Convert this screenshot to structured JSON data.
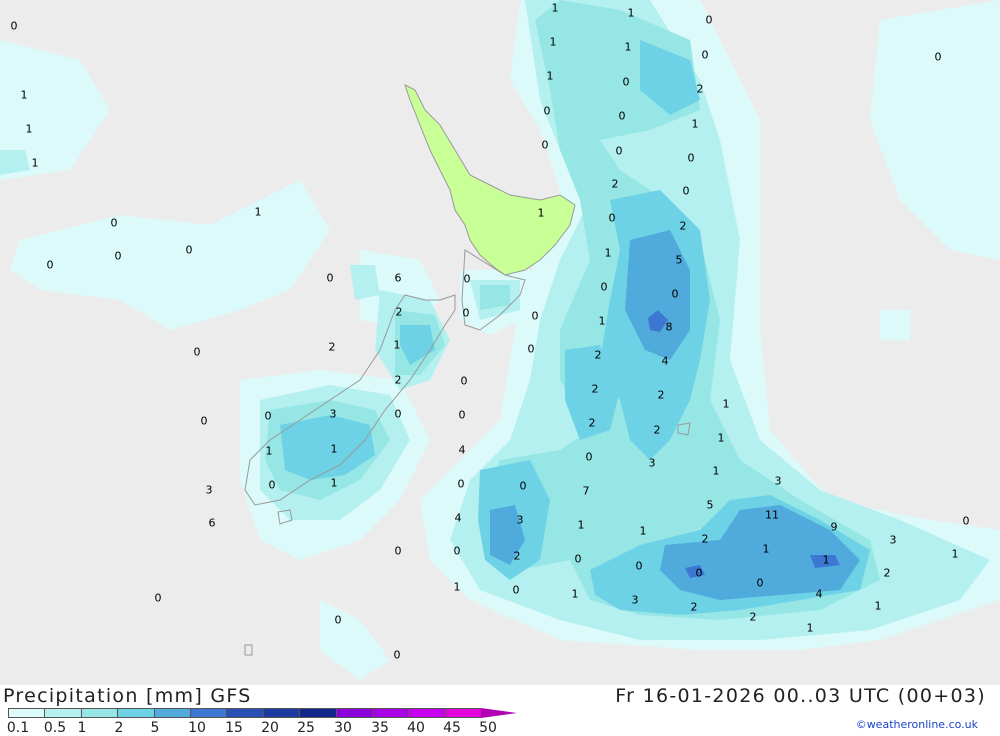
{
  "colors": {
    "ocean": "#ececec",
    "land_dry": "#c8ff96",
    "coast": "#999999",
    "precip_01": "#dcfafa",
    "precip_05": "#b4f0f0",
    "precip_1": "#96e6e6",
    "precip_2": "#6ed2e6",
    "precip_5": "#50aadc",
    "precip_10": "#3c78d2",
    "credit": "#1a44c8"
  },
  "map": {
    "labels": [
      "1",
      "1",
      "0",
      "0",
      "1",
      "1",
      "0",
      "0",
      "1",
      "0",
      "2",
      "1",
      "0",
      "0",
      "1",
      "1",
      "0",
      "0",
      "1",
      "0",
      "2",
      "0",
      "1",
      "1",
      "0",
      "0",
      "2",
      "0",
      "0",
      "5",
      "0",
      "1",
      "0",
      "6",
      "0",
      "0",
      "0",
      "0",
      "2",
      "8",
      "0",
      "1",
      "4",
      "2",
      "0",
      "2",
      "0",
      "1",
      "2",
      "0",
      "2",
      "2",
      "1",
      "0",
      "0",
      "2",
      "3",
      "0",
      "2",
      "0",
      "1",
      "3",
      "0",
      "1",
      "1",
      "4",
      "1",
      "3",
      "3",
      "0",
      "0",
      "0",
      "5",
      "1",
      "7",
      "11",
      "3",
      "9",
      "6",
      "4",
      "1",
      "1",
      "0",
      "3",
      "2",
      "1",
      "2",
      "1",
      "0",
      "0",
      "0",
      "0",
      "0",
      "1",
      "0",
      "2",
      "1"
    ]
  },
  "footer": {
    "title": "Precipitation [mm] GFS",
    "datetime": "Fr 16-01-2026 00..03 UTC (00+03)",
    "credit": "©weatheronline.co.uk",
    "legend": {
      "ticks": [
        "0.1",
        "0.5",
        "1",
        "2",
        "5",
        "10",
        "15",
        "20",
        "25",
        "30",
        "35",
        "40",
        "45",
        "50"
      ],
      "colors": [
        "#dcfafa",
        "#b4f0f0",
        "#96e6e6",
        "#6ed2e6",
        "#50aadc",
        "#3c78d2",
        "#2850b4",
        "#1e3ca0",
        "#14288c",
        "#8c00dc",
        "#aa00e6",
        "#c800f0",
        "#e600dc",
        "#b400b4"
      ]
    }
  }
}
